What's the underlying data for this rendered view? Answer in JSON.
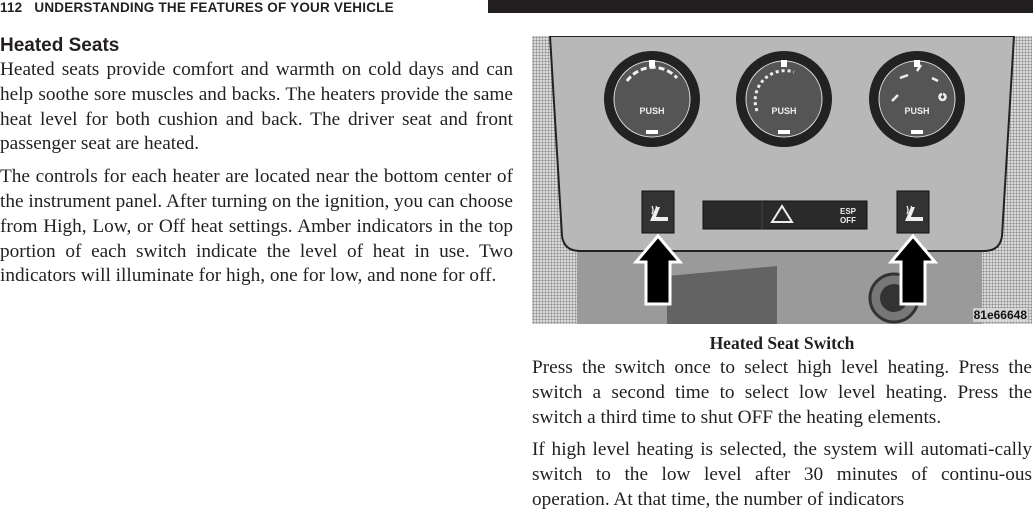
{
  "running_header": {
    "page_number": "112",
    "title": "UNDERSTANDING THE FEATURES OF YOUR VEHICLE"
  },
  "section": {
    "heading": "Heated Seats",
    "paragraphs": [
      "Heated seats provide comfort and warmth on cold days and can help soothe sore muscles and backs. The heaters provide the same heat level for both cushion and back. The driver seat and front passenger seat are heated.",
      "The controls for each heater are located near the bottom center of the instrument panel. After turning on the ignition, you can choose from High, Low, or Off heat settings. Amber indicators in the top portion of each switch indicate the level of heat in use. Two indicators will illuminate for high, one for low, and none for off."
    ]
  },
  "figure": {
    "caption": "Heated Seat Switch",
    "image_id": "81e66648",
    "dials": [
      {
        "name": "fan-speed-dial",
        "icon": "fan-icon",
        "label": "PUSH"
      },
      {
        "name": "temperature-dial",
        "icon": "ac-snowflake-icon",
        "label": "PUSH"
      },
      {
        "name": "airflow-mode-dial",
        "icon": "defrost-icon",
        "label": "PUSH"
      }
    ],
    "switches": {
      "left_heated_seat": "heated-seat-icon",
      "hazard": "hazard-triangle-icon",
      "esp_line1": "ESP",
      "esp_line2": "OFF",
      "right_heated_seat": "heated-seat-icon"
    },
    "callouts": [
      "arrow-up-icon",
      "arrow-up-icon"
    ]
  },
  "right_column": {
    "paragraphs": [
      "Press the switch once to select high level heating. Press the switch a second time to select low level heating. Press the switch a third time to shut OFF the heating elements.",
      "If high level heating is selected, the system will automati-cally switch to the low level after 30 minutes of continu-ous operation. At that time, the number of indicators"
    ]
  }
}
